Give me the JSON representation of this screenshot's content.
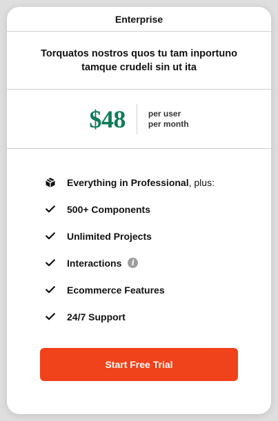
{
  "plan": {
    "name": "Enterprise",
    "tagline_line1": "Torquatos nostros quos tu tam inportuno",
    "tagline_line2": "tamque crudeli sin ut ita",
    "price": "$48",
    "per_line1": "per user",
    "per_line2": "per month",
    "accent_color": "#0f7a5a"
  },
  "features": {
    "lead": {
      "icon": "cube-icon",
      "strong": "Everything in Professional",
      "rest": ", plus:"
    },
    "items": [
      {
        "label": "500+ Components",
        "icon": "check-icon"
      },
      {
        "label": "Unlimited Projects",
        "icon": "check-icon"
      },
      {
        "label": "Interactions",
        "icon": "check-icon",
        "info_icon": "info-icon",
        "info_glyph": "i"
      },
      {
        "label": "Ecommerce Features",
        "icon": "check-icon"
      },
      {
        "label": "24/7 Support",
        "icon": "check-icon"
      }
    ]
  },
  "cta": {
    "label": "Start Free Trial",
    "color": "#f0421b"
  }
}
